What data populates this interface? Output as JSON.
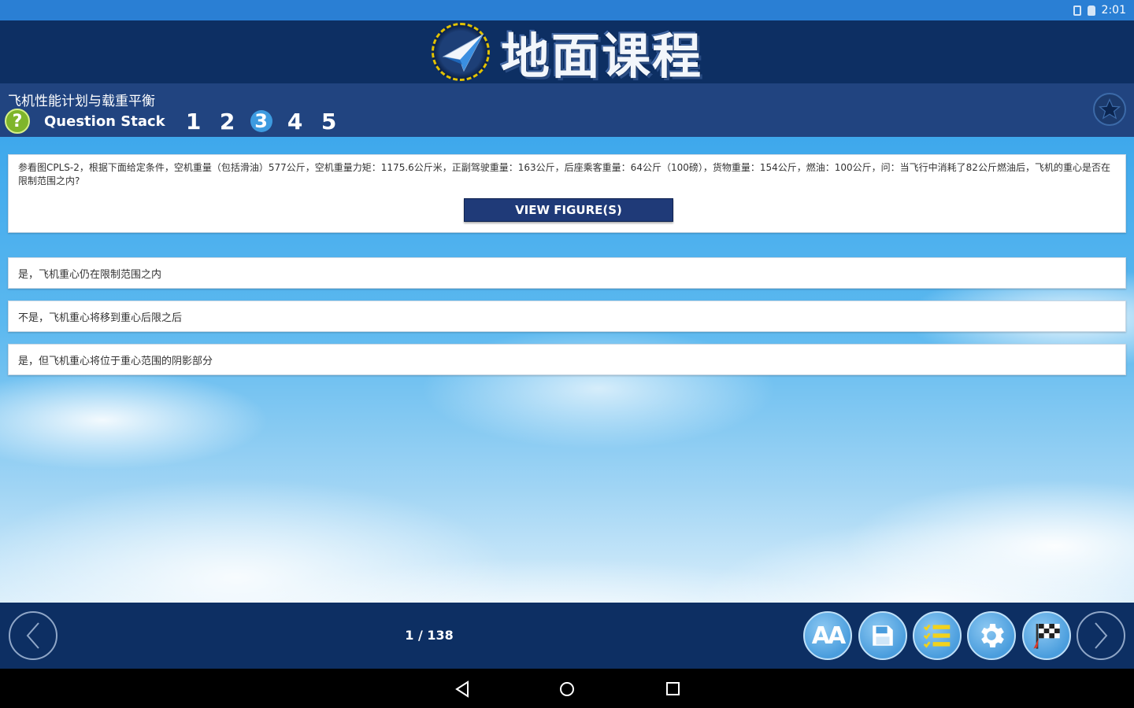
{
  "status_bar": {
    "time": "2:01"
  },
  "header": {
    "app_title": "地面课程",
    "logo_icon": "paper-plane-icon"
  },
  "subheader": {
    "subject": "飞机性能计划与载重平衡",
    "question_stack_label": "Question Stack",
    "stack_numbers": [
      "1",
      "2",
      "3",
      "4",
      "5"
    ],
    "active_index": 2,
    "help_label": "?"
  },
  "question": {
    "text": "参看图CPLS-2，根据下面给定条件，空机重量（包括滑油）577公斤，空机重量力矩：1175.6公斤米，正副驾驶重量：163公斤，后座乘客重量：64公斤（100磅），货物重量：154公斤，燃油：100公斤，问：当飞行中消耗了82公斤燃油后，飞机的重心是否在限制范围之内?",
    "view_figures_label": "VIEW FIGURE(S)"
  },
  "answers": [
    {
      "text": "是，飞机重心仍在限制范围之内"
    },
    {
      "text": "不是，飞机重心将移到重心后限之后"
    },
    {
      "text": "是，但飞机重心将位于重心范围的阴影部分"
    }
  ],
  "footer": {
    "page_counter": "1 / 138",
    "font_size_label": "AA",
    "colors": {
      "bar": "#0d2f63",
      "tool_button": "#4a9ddd"
    }
  }
}
